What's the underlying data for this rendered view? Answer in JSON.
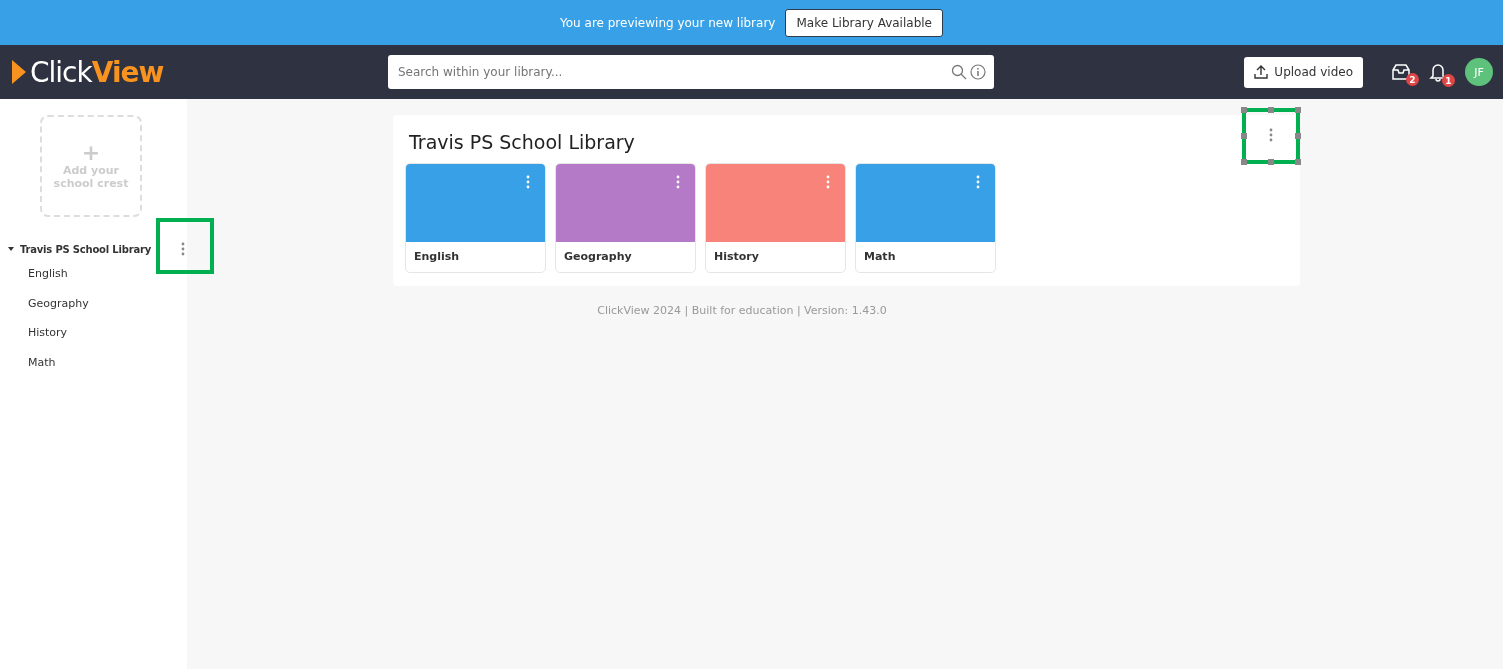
{
  "banner": {
    "message": "You are previewing your new library",
    "button": "Make Library Available"
  },
  "header": {
    "logo": "Click**View**",
    "search": {
      "placeholder": "Search within your library..."
    },
    "upload_button": "Upload video",
    "inbox_badge": "2",
    "notifications_badge": "1",
    "avatar": "JF"
  },
  "sidebar": {
    "crest": {
      "plus": "+",
      "label": "Add your school crest"
    },
    "tree": [
      {
        "label": "Travis PS School Library",
        "expanded": true,
        "children": [
          {
            "label": "English"
          },
          {
            "label": "Geography"
          },
          {
            "label": "History"
          },
          {
            "label": "Math"
          }
        ]
      }
    ]
  },
  "library": {
    "title": "Travis PS School Library",
    "categories": [
      {
        "label": "English",
        "color": "#38a0e6"
      },
      {
        "label": "Geography",
        "color": "#b57ac7"
      },
      {
        "label": "History",
        "color": "#f7837a"
      },
      {
        "label": "Math",
        "color": "#38a0e6"
      }
    ]
  },
  "footer": "ClickView 2024 | Built for education | Version: 1.43.0"
}
